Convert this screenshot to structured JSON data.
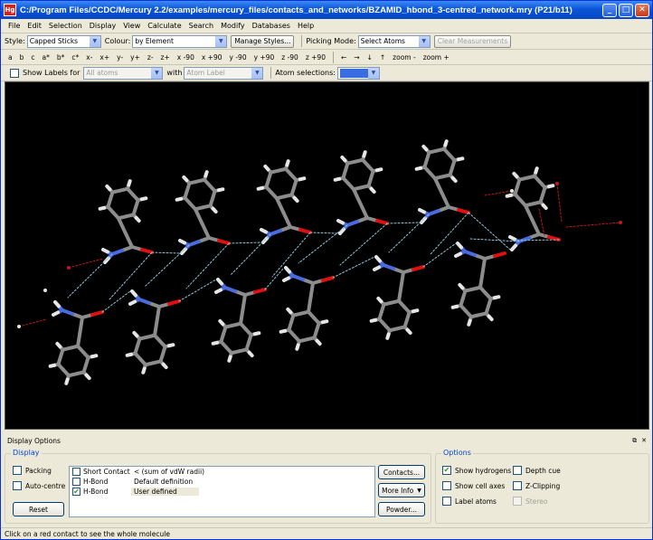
{
  "window": {
    "title": "C:/Program Files/CCDC/Mercury 2.2/examples/mercury_files/contacts_and_networks/BZAMID_hbond_3-centred_network.mry (P21/b11)",
    "app_icon": "Hg",
    "minimize": "_",
    "maximize": "□",
    "close": "✕"
  },
  "menu": [
    "File",
    "Edit",
    "Selection",
    "Display",
    "View",
    "Calculate",
    "Search",
    "Modify",
    "Databases",
    "Help"
  ],
  "toolbar1": {
    "style_label": "Style:",
    "style_value": "Capped Sticks",
    "colour_label": "Colour:",
    "colour_value": "by Element",
    "manage_styles": "Manage Styles...",
    "picking_label": "Picking Mode:",
    "picking_value": "Select Atoms",
    "clear_measurements": "Clear Measurements"
  },
  "toolbar2": {
    "axes": [
      "a",
      "b",
      "c",
      "a*",
      "b*",
      "c*"
    ],
    "rotations": [
      "x-",
      "x+",
      "y-",
      "y+",
      "z-",
      "z+"
    ],
    "angles": [
      "x -90",
      "x +90",
      "y -90",
      "y +90",
      "z -90",
      "z +90"
    ],
    "arrows": [
      "←",
      "→",
      "↓",
      "↑"
    ],
    "zoom_out": "zoom -",
    "zoom_in": "zoom +"
  },
  "toolbar3": {
    "show_labels": "Show Labels for",
    "labels_for_value": "All atoms",
    "with_label": "with",
    "with_value": "Atom Label",
    "atom_selections_label": "Atom selections:"
  },
  "display_options": {
    "header": "Display Options",
    "float_icon": "⧉",
    "close_icon": "✕",
    "display_group": "Display",
    "packing": "Packing",
    "auto_centre": "Auto-centre",
    "reset": "Reset",
    "contacts": [
      {
        "name": "Short Contact",
        "definition": "< (sum of vdW radii)",
        "checked": false
      },
      {
        "name": "H-Bond",
        "definition": "Default definition",
        "checked": false
      },
      {
        "name": "H-Bond",
        "definition": "User defined",
        "checked": true
      }
    ],
    "contacts_button": "Contacts...",
    "more_info_button": "More Info",
    "powder_button": "Powder...",
    "options_group": "Options",
    "show_hydrogens": "Show hydrogens",
    "depth_cue": "Depth cue",
    "show_cell_axes": "Show cell axes",
    "z_clipping": "Z-Clipping",
    "label_atoms": "Label atoms",
    "stereo": "Stereo"
  },
  "status": "Click on a red contact to see the whole molecule",
  "colors": {
    "carbon": "#8c8c8c",
    "hydrogen": "#e6e6e6",
    "oxygen": "#e01010",
    "nitrogen": "#4a6ae0",
    "hbond": "#8fc8d8",
    "contact": "#c01818"
  }
}
